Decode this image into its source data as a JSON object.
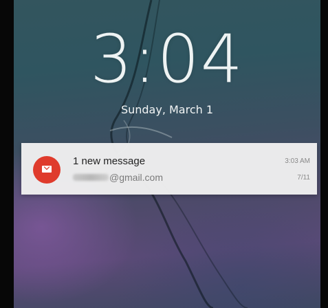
{
  "lock_screen": {
    "time": "3:04",
    "date": "Sunday, March 1"
  },
  "notification": {
    "icon": "gmail-icon",
    "accent_color": "#df3b2c",
    "title": "1 new message",
    "sender_domain": "@gmail.com",
    "time": "3:03 AM",
    "date": "7/11"
  }
}
